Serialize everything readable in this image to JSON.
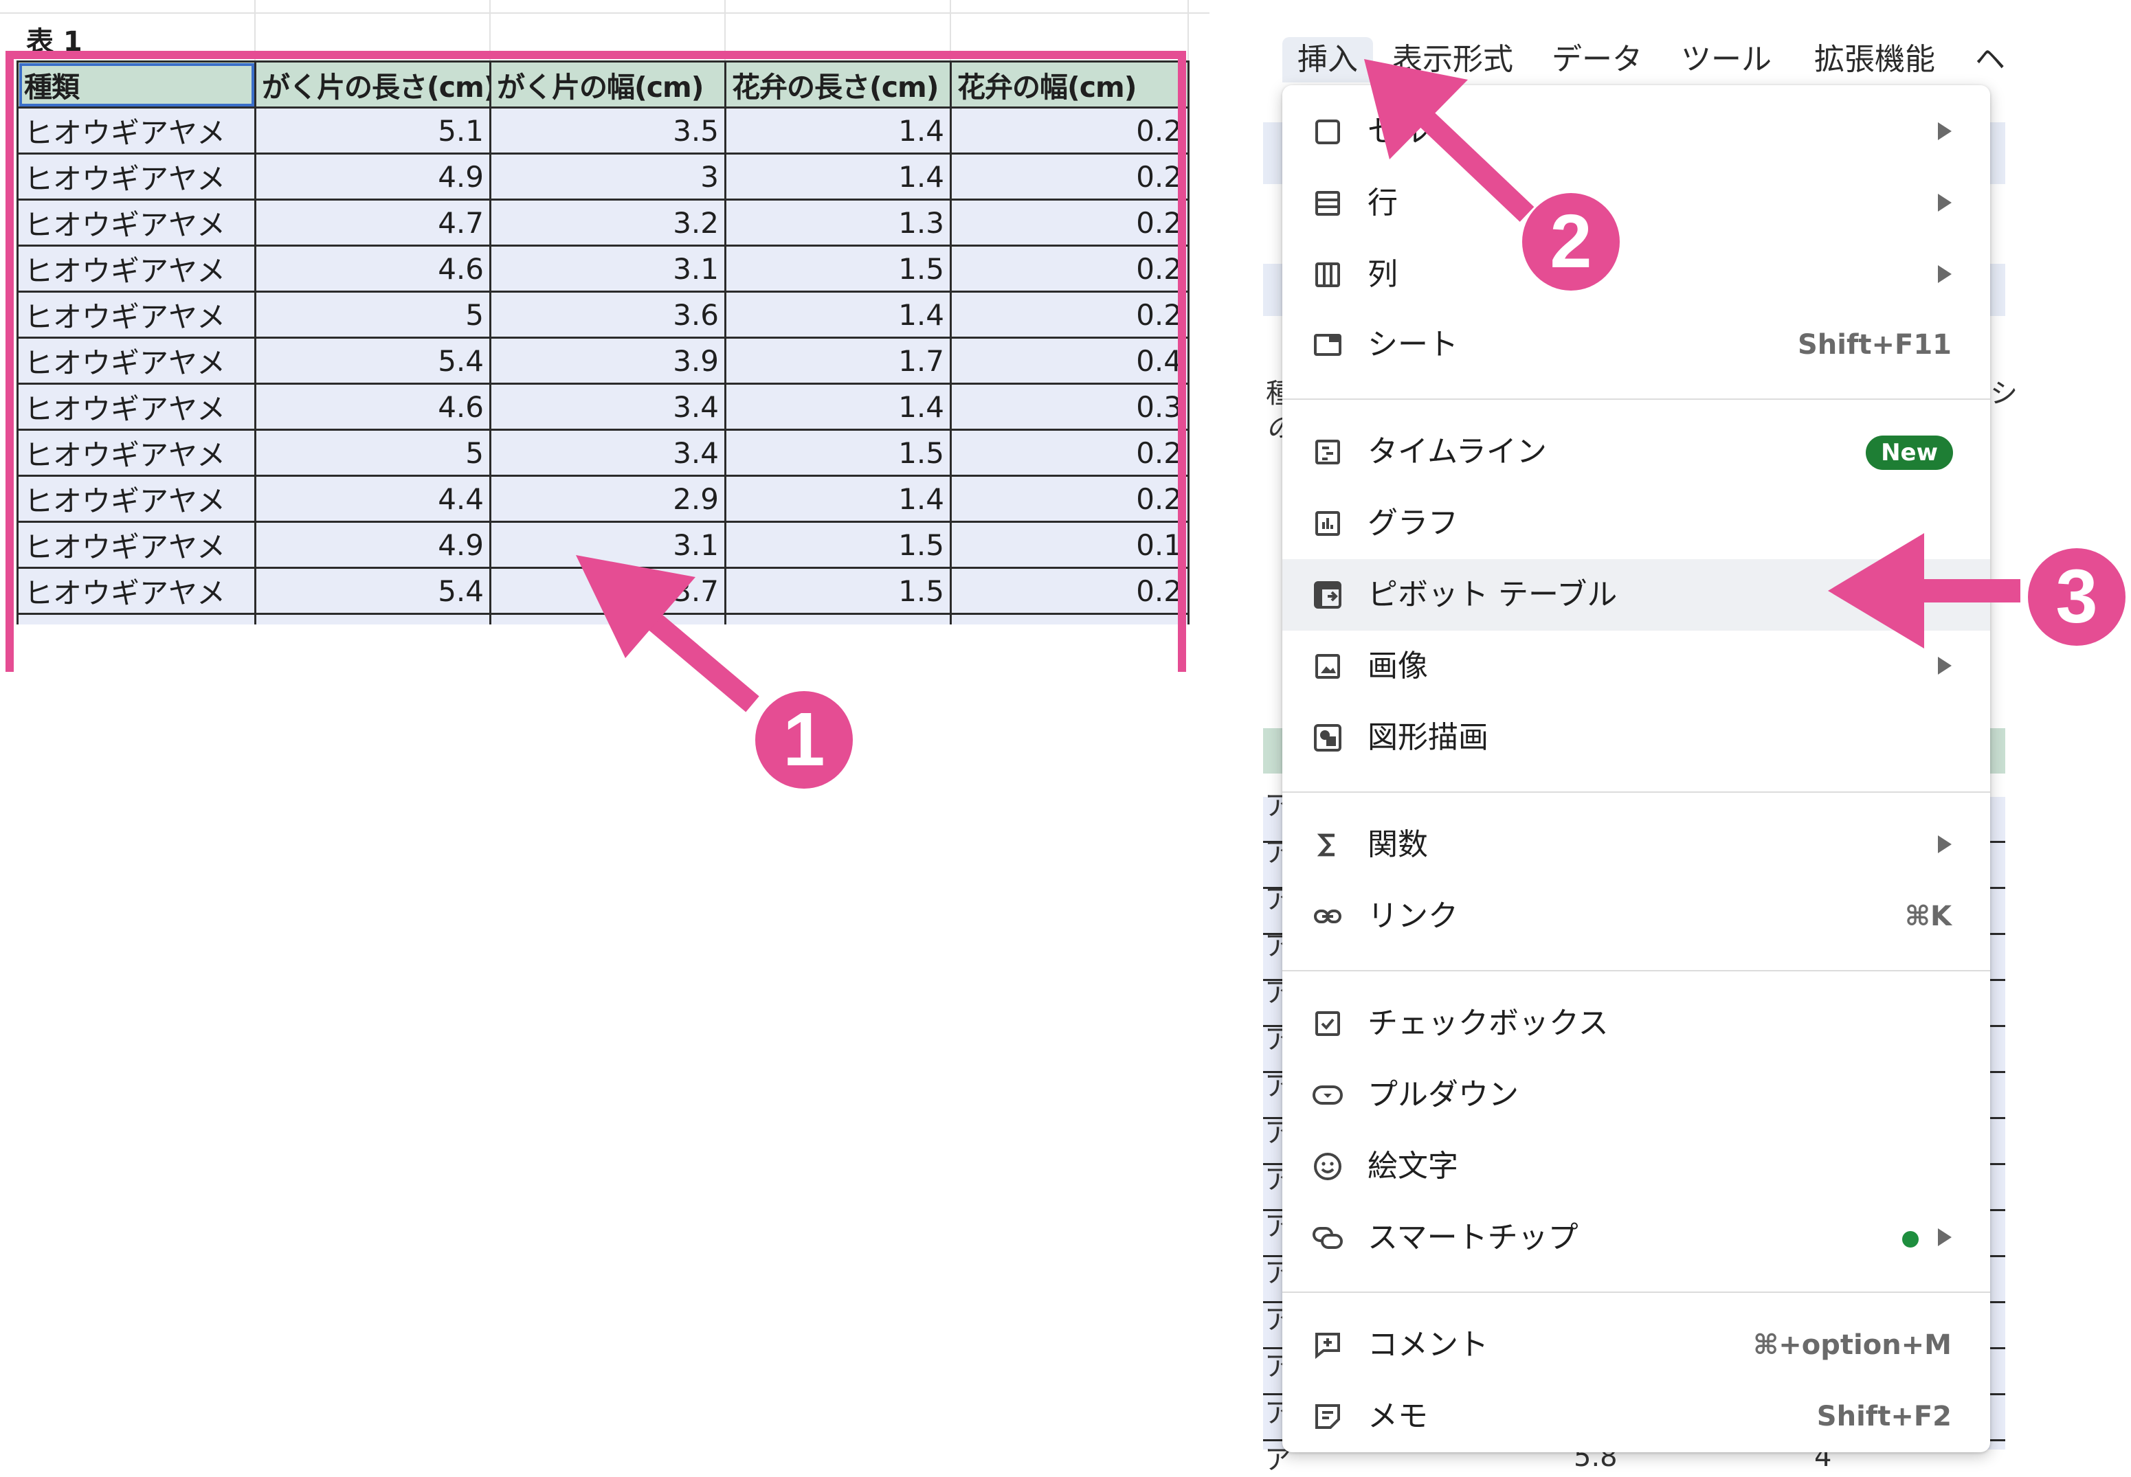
{
  "sheet": {
    "title": "表 1",
    "headers": [
      "種類",
      "がく片の長さ(cm)",
      "がく片の幅(cm)",
      "花弁の長さ(cm)",
      "花弁の幅(cm)"
    ],
    "rows": [
      [
        "ヒオウギアヤメ",
        "5.1",
        "3.5",
        "1.4",
        "0.2"
      ],
      [
        "ヒオウギアヤメ",
        "4.9",
        "3",
        "1.4",
        "0.2"
      ],
      [
        "ヒオウギアヤメ",
        "4.7",
        "3.2",
        "1.3",
        "0.2"
      ],
      [
        "ヒオウギアヤメ",
        "4.6",
        "3.1",
        "1.5",
        "0.2"
      ],
      [
        "ヒオウギアヤメ",
        "5",
        "3.6",
        "1.4",
        "0.2"
      ],
      [
        "ヒオウギアヤメ",
        "5.4",
        "3.9",
        "1.7",
        "0.4"
      ],
      [
        "ヒオウギアヤメ",
        "4.6",
        "3.4",
        "1.4",
        "0.3"
      ],
      [
        "ヒオウギアヤメ",
        "5",
        "3.4",
        "1.5",
        "0.2"
      ],
      [
        "ヒオウギアヤメ",
        "4.4",
        "2.9",
        "1.4",
        "0.2"
      ],
      [
        "ヒオウギアヤメ",
        "4.9",
        "3.1",
        "1.5",
        "0.1"
      ],
      [
        "ヒオウギアヤメ",
        "5.4",
        "3.7",
        "1.5",
        "0.2"
      ]
    ]
  },
  "menubar": {
    "items": [
      "挿入",
      "表示形式",
      "データ",
      "ツール",
      "拡張機能",
      "ヘ"
    ]
  },
  "background": {
    "chars": [
      "種",
      "の",
      "シ",
      "ア",
      "ア",
      "ア",
      "ア",
      "ア",
      "ア",
      "ア",
      "ア",
      "ア",
      "ア",
      "ア",
      "ア",
      "ア",
      "ア",
      "ア"
    ],
    "bottom_values": [
      "5.8",
      "4"
    ]
  },
  "insert_menu": {
    "items": [
      {
        "id": "cells",
        "label": "セル",
        "icon": "cell-icon",
        "submenu": true
      },
      {
        "id": "rows",
        "label": "行",
        "icon": "rows-icon",
        "submenu": true
      },
      {
        "id": "columns",
        "label": "列",
        "icon": "columns-icon",
        "submenu": true
      },
      {
        "id": "sheet",
        "label": "シート",
        "icon": "sheet-icon",
        "shortcut": "Shift+F11"
      },
      {
        "id": "timeline",
        "label": "タイムライン",
        "icon": "timeline-icon",
        "badge": "New"
      },
      {
        "id": "chart",
        "label": "グラフ",
        "icon": "chart-icon"
      },
      {
        "id": "pivot",
        "label": "ピボット テーブル",
        "icon": "pivot-table-icon"
      },
      {
        "id": "image",
        "label": "画像",
        "icon": "image-icon",
        "submenu": true
      },
      {
        "id": "drawing",
        "label": "図形描画",
        "icon": "drawing-icon"
      },
      {
        "id": "function",
        "label": "関数",
        "icon": "sigma-icon",
        "submenu": true
      },
      {
        "id": "link",
        "label": "リンク",
        "icon": "link-icon",
        "shortcut": "⌘K"
      },
      {
        "id": "checkbox",
        "label": "チェックボックス",
        "icon": "checkbox-icon"
      },
      {
        "id": "dropdown",
        "label": "プルダウン",
        "icon": "dropdown-icon"
      },
      {
        "id": "emoji",
        "label": "絵文字",
        "icon": "emoji-icon"
      },
      {
        "id": "smartchips",
        "label": "スマートチップ",
        "icon": "smart-chip-icon",
        "submenu": true,
        "dot": true
      },
      {
        "id": "comment",
        "label": "コメント",
        "icon": "comment-icon",
        "shortcut": "⌘+option+M"
      },
      {
        "id": "note",
        "label": "メモ",
        "icon": "note-icon",
        "shortcut": "Shift+F2"
      }
    ]
  },
  "annotations": {
    "color": "#e54d93",
    "steps": [
      "1",
      "2",
      "3"
    ]
  }
}
